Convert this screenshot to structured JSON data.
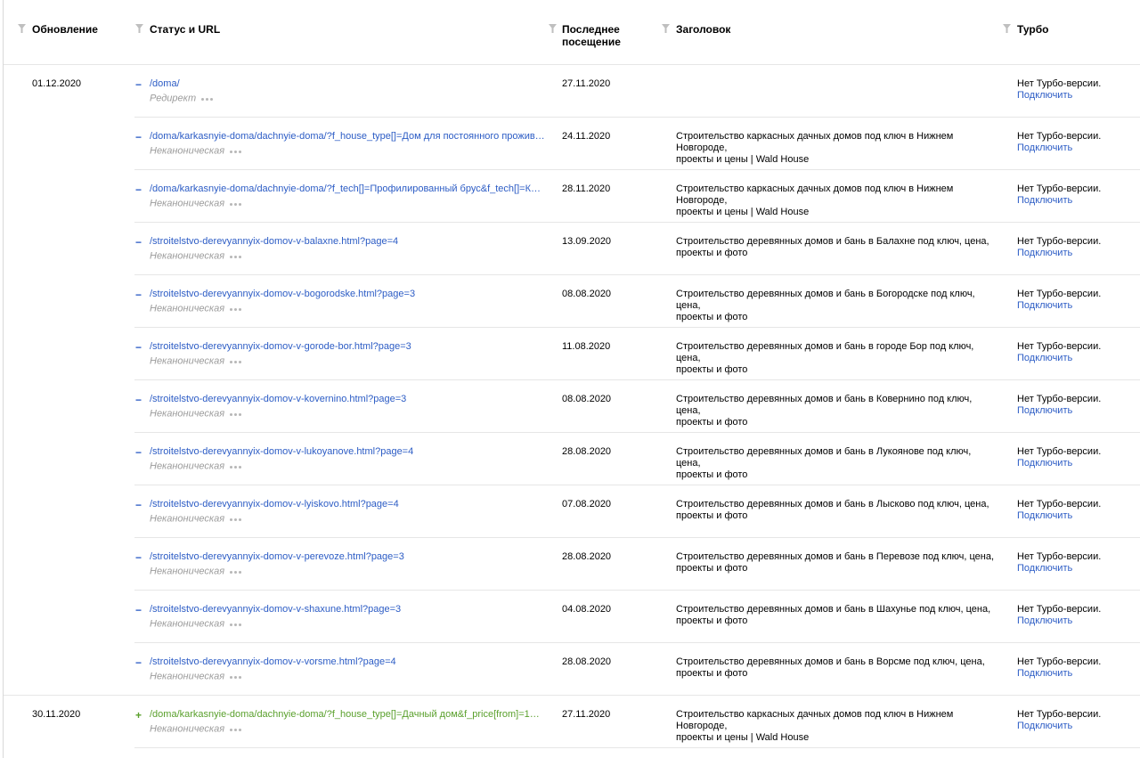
{
  "header": {
    "update": "Обновление",
    "status_url": "Статус и URL",
    "last_visit_line1": "Последнее",
    "last_visit_line2": "посещение",
    "title": "Заголовок",
    "turbo": "Турбо"
  },
  "groups": [
    {
      "date": "01.12.2020",
      "rows": [
        {
          "mark": "−",
          "url": "/doma/",
          "status": "Редирект",
          "visit": "27.11.2020",
          "title1": "",
          "title2": "",
          "turbo": "Нет Турбо-версии.",
          "turbo_link": "Подключить"
        },
        {
          "mark": "−",
          "url": "/doma/karkasnyie-doma/dachnyie-doma/?f_house_type[]=Дом для постоянного проживани…",
          "status": "Неканоническая",
          "visit": "24.11.2020",
          "title1": "Строительство каркасных дачных домов под ключ в Нижнем Новгороде,",
          "title2": "проекты и цены | Wald House",
          "turbo": "Нет Турбо-версии.",
          "turbo_link": "Подключить"
        },
        {
          "mark": "−",
          "url": "/doma/karkasnyie-doma/dachnyie-doma/?f_tech[]=Профилированный брус&f_tech[]=Каркас…",
          "status": "Неканоническая",
          "visit": "28.11.2020",
          "title1": "Строительство каркасных дачных домов под ключ в Нижнем Новгороде,",
          "title2": "проекты и цены | Wald House",
          "turbo": "Нет Турбо-версии.",
          "turbo_link": "Подключить"
        },
        {
          "mark": "−",
          "url": "/stroitelstvo-derevyannyix-domov-v-balaxne.html?page=4",
          "status": "Неканоническая",
          "visit": "13.09.2020",
          "title1": "Строительство деревянных домов и бань в Балахне под ключ, цена,",
          "title2": "проекты и фото",
          "turbo": "Нет Турбо-версии.",
          "turbo_link": "Подключить"
        },
        {
          "mark": "−",
          "url": "/stroitelstvo-derevyannyix-domov-v-bogorodske.html?page=3",
          "status": "Неканоническая",
          "visit": "08.08.2020",
          "title1": "Строительство деревянных домов и бань в Богородске под ключ, цена,",
          "title2": "проекты и фото",
          "turbo": "Нет Турбо-версии.",
          "turbo_link": "Подключить"
        },
        {
          "mark": "−",
          "url": "/stroitelstvo-derevyannyix-domov-v-gorode-bor.html?page=3",
          "status": "Неканоническая",
          "visit": "11.08.2020",
          "title1": "Строительство деревянных домов и бань в городе Бор под ключ, цена,",
          "title2": "проекты и фото",
          "turbo": "Нет Турбо-версии.",
          "turbo_link": "Подключить"
        },
        {
          "mark": "−",
          "url": "/stroitelstvo-derevyannyix-domov-v-kovernino.html?page=3",
          "status": "Неканоническая",
          "visit": "08.08.2020",
          "title1": "Строительство деревянных домов и бань в Ковернино под ключ, цена,",
          "title2": "проекты и фото",
          "turbo": "Нет Турбо-версии.",
          "turbo_link": "Подключить"
        },
        {
          "mark": "−",
          "url": "/stroitelstvo-derevyannyix-domov-v-lukoyanove.html?page=4",
          "status": "Неканоническая",
          "visit": "28.08.2020",
          "title1": "Строительство деревянных домов и бань в Лукоянове под ключ, цена,",
          "title2": "проекты и фото",
          "turbo": "Нет Турбо-версии.",
          "turbo_link": "Подключить"
        },
        {
          "mark": "−",
          "url": "/stroitelstvo-derevyannyix-domov-v-lyiskovo.html?page=4",
          "status": "Неканоническая",
          "visit": "07.08.2020",
          "title1": "Строительство деревянных домов и бань в Лысково под ключ, цена,",
          "title2": "проекты и фото",
          "turbo": "Нет Турбо-версии.",
          "turbo_link": "Подключить"
        },
        {
          "mark": "−",
          "url": "/stroitelstvo-derevyannyix-domov-v-perevoze.html?page=3",
          "status": "Неканоническая",
          "visit": "28.08.2020",
          "title1": "Строительство деревянных домов и бань в Перевозе под ключ, цена,",
          "title2": "проекты и фото",
          "turbo": "Нет Турбо-версии.",
          "turbo_link": "Подключить"
        },
        {
          "mark": "−",
          "url": "/stroitelstvo-derevyannyix-domov-v-shaxune.html?page=3",
          "status": "Неканоническая",
          "visit": "04.08.2020",
          "title1": "Строительство деревянных домов и бань в Шахунье под ключ, цена,",
          "title2": "проекты и фото",
          "turbo": "Нет Турбо-версии.",
          "turbo_link": "Подключить"
        },
        {
          "mark": "−",
          "url": "/stroitelstvo-derevyannyix-domov-v-vorsme.html?page=4",
          "status": "Неканоническая",
          "visit": "28.08.2020",
          "title1": "Строительство деревянных домов и бань в Ворсме под ключ, цена,",
          "title2": "проекты и фото",
          "turbo": "Нет Турбо-версии.",
          "turbo_link": "Подключить"
        }
      ]
    },
    {
      "date": "30.11.2020",
      "rows": [
        {
          "mark": "+",
          "url": "/doma/karkasnyie-doma/dachnyie-doma/?f_house_type[]=Дачный дом&f_price[from]=1&f_pri…",
          "status": "Неканоническая",
          "visit": "27.11.2020",
          "title1": "Строительство каркасных дачных домов под ключ в Нижнем Новгороде,",
          "title2": "проекты и цены | Wald House",
          "turbo": "Нет Турбо-версии.",
          "turbo_link": "Подключить"
        }
      ]
    }
  ],
  "colors": {
    "link": "#2c5cc5",
    "added": "#5aa02c",
    "muted": "#9b9b9b",
    "divider": "#e6e6e6"
  }
}
